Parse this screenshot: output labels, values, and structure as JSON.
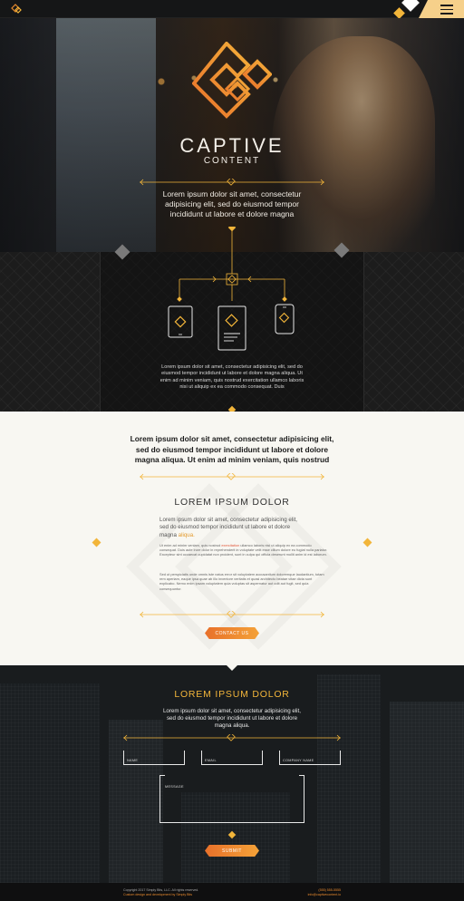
{
  "brand": {
    "name": "CAPTIVE",
    "tagline": "CONTENT"
  },
  "hero": {
    "text": "Lorem ipsum dolor sit amet, consectetur adipisicing elit, sed do eiusmod tempor incididunt ut labore et dolore magna"
  },
  "services": {
    "text": "Lorem ipsum dolor sit amet, consectetur adipisicing elit, sed do eiusmod tempor incididunt ut labore et dolore magna aliqua. Ut enim ad minim veniam, quis nostrud exercitation ullamco laboris nisi ut aliquip ex ea commodo consequat. Duis"
  },
  "about": {
    "lead": "Lorem ipsum dolor sit amet, consectetur adipisicing elit, sed do eiusmod tempor incididunt ut labore et dolore magna aliqua. Ut enim ad minim veniam, quis nostrud",
    "heading": "LOREM IPSUM DOLOR",
    "para1": "Lorem ipsum dolor sit amet, consectetur adipisicing elit, sed do eiusmod tempor incididunt ut labore et dolore magna",
    "para1_highlight": "aliqua.",
    "para2_a": "Ut enim ad minim veniam, quis nostrud",
    "para2_highlight": "exercitation",
    "para2_b": "ullamco laboris nisi ut aliquip ex ea commodo consequat. Duis aute irure dolor in reprehenderit in voluptate velit esse cillum dolore eu fugiat nulla pariatur. Excepteur sint occaecat cupidatat non proident, sunt in culpa qui officia deserunt mollit anim id est laborum.",
    "para3": "Sed ut perspiciatis unde omnis iste natus error sit voluptatem accusantium doloremque laudantium, totam rem aperiam, eaque ipsa quae ab illo inventore veritatis et quasi architecto beatae vitae dicta sunt explicabo. Nemo enim ipsam voluptatem quia voluptas sit aspernatur aut odit aut fugit, sed quia consequuntur.",
    "button": "CONTACT US"
  },
  "contact": {
    "heading": "LOREM IPSUM DOLOR",
    "intro": "Lorem ipsum dolor sit amet, consectetur adipisicing elit, sed do eiusmod tempor incididunt ut labore et dolore magna aliqua.",
    "fields": {
      "name": "NAME",
      "email": "EMAIL",
      "company": "COMPANY NAME",
      "message": "MESSAGE"
    },
    "button": "SUBMIT"
  },
  "footer": {
    "copyright": "Copyright 2017 Simply Bits, LLC. All rights reserved.",
    "credit": "Custom design and development by Simply Bits",
    "phone": "(555) 555-5555",
    "email": "info@captivecontent.io"
  },
  "colors": {
    "accent": "#f2b53a",
    "accent_dark": "#e8702a",
    "cream": "#f8f7f2"
  },
  "icons": [
    "logo-mark",
    "hamburger-menu-icon",
    "tablet-icon",
    "desktop-icon",
    "phone-icon"
  ]
}
